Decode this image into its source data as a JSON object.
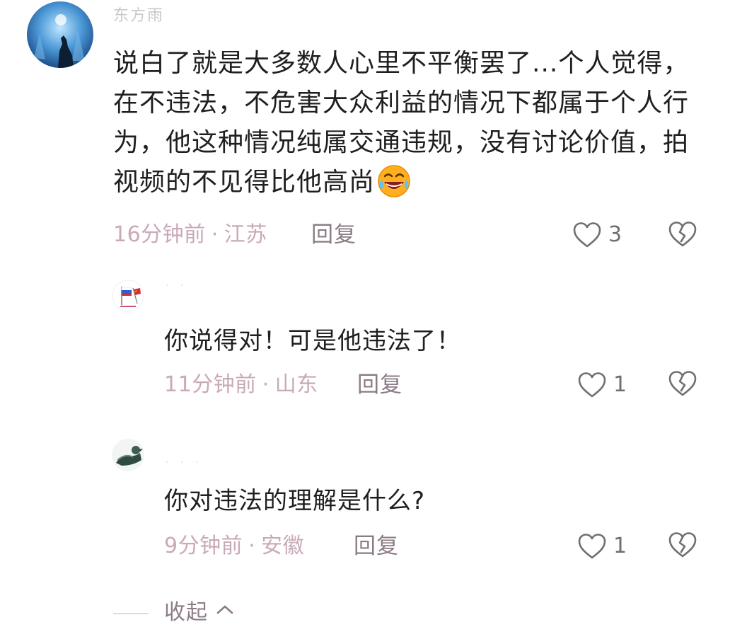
{
  "main_comment": {
    "username": "东方雨",
    "text": "说白了就是大多数人心里不平衡罢了...个人觉得，在不违法，不危害大众利益的情况下都属于个人行为，他这种情况纯属交通违规，没有讨论价值，拍视频的不见得比他高尚",
    "emoji": "face-with-tears-of-joy-icon",
    "time": "16分钟前",
    "location": "江苏",
    "reply_label": "回复",
    "likes": "3"
  },
  "replies": [
    {
      "text": "你说得对！可是他违法了！",
      "time": "11分钟前",
      "location": "山东",
      "reply_label": "回复",
      "likes": "1"
    },
    {
      "text": "你对违法的理解是什么?",
      "time": "9分钟前",
      "location": "安徽",
      "reply_label": "回复",
      "likes": "1"
    }
  ],
  "meta_separator": "·",
  "collapse_label": "收起",
  "colors": {
    "meta_pink": "#c9a9b8",
    "action_gray": "#8b7b86",
    "text": "#1f1f1f"
  }
}
